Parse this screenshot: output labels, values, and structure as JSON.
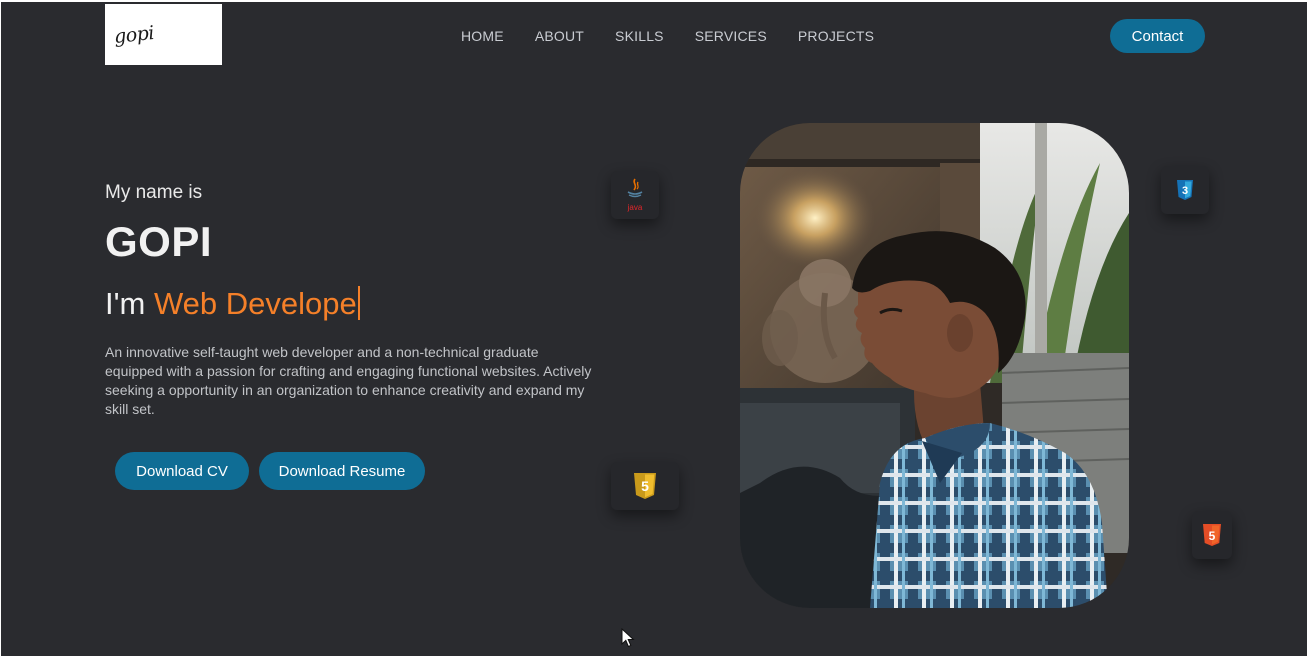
{
  "logo": {
    "text": "gopi"
  },
  "nav": {
    "items": [
      {
        "label": "HOME"
      },
      {
        "label": "ABOUT"
      },
      {
        "label": "SKILLS"
      },
      {
        "label": "SERVICES"
      },
      {
        "label": "PROJECTS"
      }
    ],
    "contact_label": "Contact"
  },
  "hero": {
    "intro": "My name is",
    "name": "GOPI",
    "prefix": "I'm ",
    "role_typed": "Web Develope",
    "description": "An innovative self-taught web developer and a non-technical graduate equipped with a passion for crafting and engaging functional websites. Actively seeking a opportunity in an organization to enhance creativity and expand my skill set.",
    "buttons": {
      "cv": "Download CV",
      "resume": "Download Resume"
    }
  },
  "skills": {
    "java_label": "java",
    "css_label": "3",
    "js_label": "5",
    "html_label": "5"
  },
  "colors": {
    "background": "#2a2b2f",
    "accent": "#f58029",
    "button": "#0f6d95",
    "text": "#f1f1f1"
  },
  "icons": [
    "java-icon",
    "css3-icon",
    "javascript-icon",
    "html5-icon",
    "mouse-cursor-icon"
  ]
}
